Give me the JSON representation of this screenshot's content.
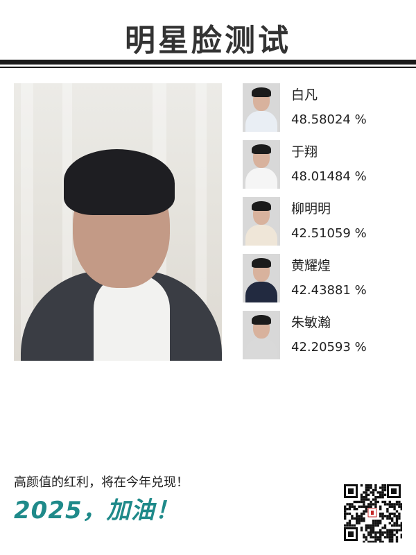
{
  "header": {
    "title": "明星脸测试"
  },
  "matches": [
    {
      "name": "白凡",
      "score": "48.58024 %",
      "shirt_color": "#e9eef4"
    },
    {
      "name": "于翔",
      "score": "48.01484 %",
      "shirt_color": "#f5f5f5"
    },
    {
      "name": "柳明明",
      "score": "42.51059 %",
      "shirt_color": "#efe6d8"
    },
    {
      "name": "黄耀煌",
      "score": "42.43881 %",
      "shirt_color": "#222a40"
    },
    {
      "name": "朱敏瀚",
      "score": "42.20593 %",
      "shirt_color": "#d9d9d9"
    }
  ],
  "footer": {
    "slogan": "高颜值的红利，将在今年兑现！",
    "cheer": "2025，加油！"
  },
  "colors": {
    "accent": "#1f8a8a",
    "rule": "#1a1a1a"
  }
}
